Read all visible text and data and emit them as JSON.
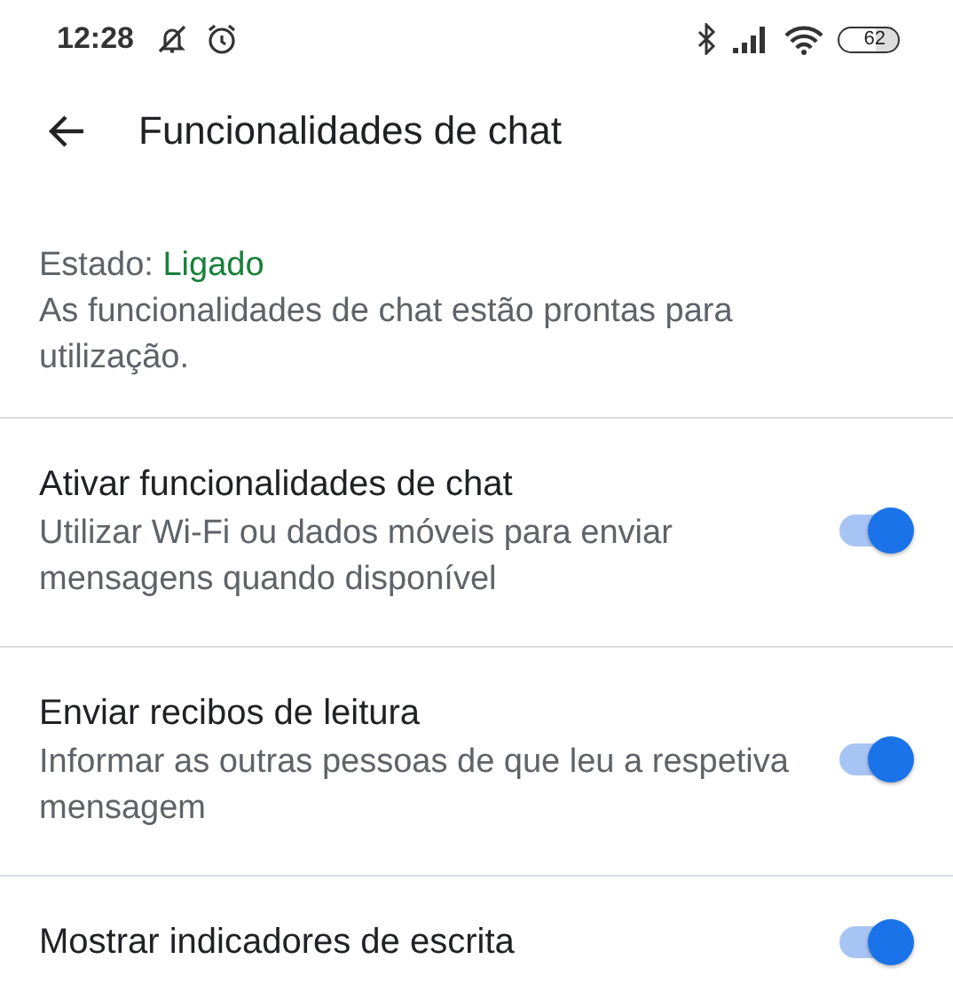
{
  "status_bar": {
    "time": "12:28",
    "battery": "62"
  },
  "header": {
    "title": "Funcionalidades de chat"
  },
  "status": {
    "label": "Estado:",
    "value": "Ligado",
    "description": "As funcionalidades de chat estão prontas para utilização."
  },
  "settings": [
    {
      "title": "Ativar funcionalidades de chat",
      "subtitle": "Utilizar Wi-Fi ou dados móveis para enviar mensagens quando disponível",
      "on": true
    },
    {
      "title": "Enviar recibos de leitura",
      "subtitle": "Informar as outras pessoas de que leu a respetiva mensagem",
      "on": true
    },
    {
      "title": "Mostrar indicadores de escrita",
      "on": true
    }
  ]
}
